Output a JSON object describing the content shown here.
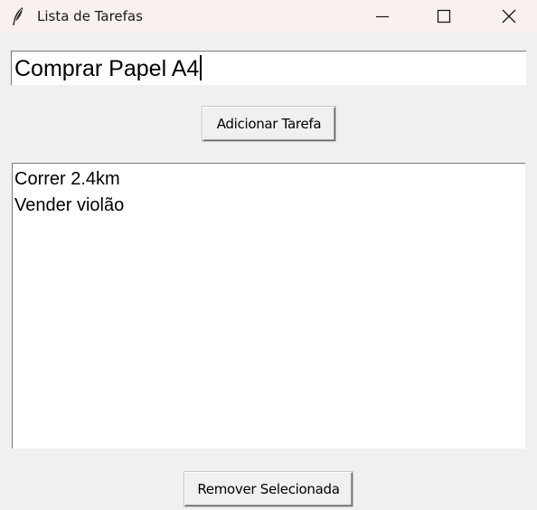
{
  "window": {
    "title": "Lista de Tarefas",
    "icon": "feather-icon"
  },
  "task_entry": {
    "value": "Comprar Papel A4"
  },
  "buttons": {
    "add_label": "Adicionar Tarefa",
    "remove_label": "Remover Selecionada"
  },
  "tasks": [
    {
      "label": "Correr 2.4km"
    },
    {
      "label": "Vender violão"
    }
  ]
}
